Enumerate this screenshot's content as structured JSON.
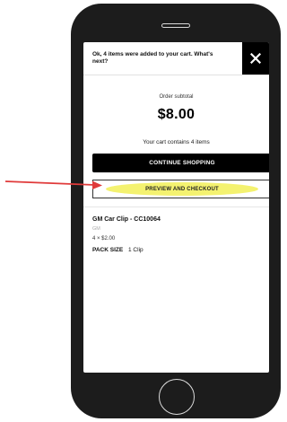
{
  "modal": {
    "header_message": "Ok, 4 items were added to your cart. What's next?",
    "close_icon": "close-icon",
    "subtotal_label": "Order subtotal",
    "subtotal_value": "$8.00",
    "cart_count_text": "Your cart contains 4 items",
    "continue_label": "CONTINUE SHOPPING",
    "checkout_label": "PREVIEW AND CHECKOUT"
  },
  "product": {
    "name": "GM Car Clip - CC10064",
    "brand": "GM",
    "quantity_price": "4 × $2.00",
    "pack_size_label": "PACK SIZE",
    "pack_size_value": "1 Clip"
  },
  "colors": {
    "annotation_arrow": "#e03a3a",
    "highlight": "#f4f270",
    "phone_body": "#1c1c1c"
  }
}
